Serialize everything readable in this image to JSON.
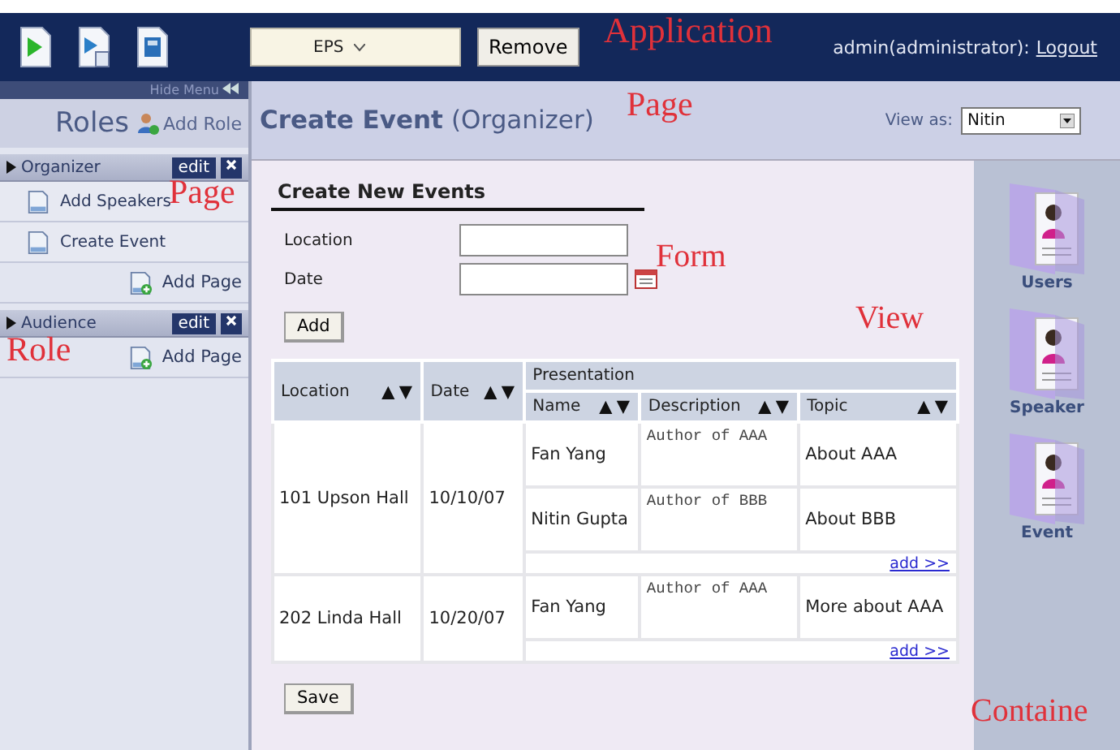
{
  "header": {
    "format_select": {
      "value": "EPS"
    },
    "remove_button": "Remove",
    "user": "admin(administrator):",
    "logout": "Logout"
  },
  "sidebar": {
    "hide_menu": "Hide Menu",
    "title": "Roles",
    "add_role": "Add Role",
    "roles": [
      {
        "name": "Organizer",
        "edit": "edit",
        "pages": [
          "Add Speakers",
          "Create Event"
        ],
        "add_page": "Add Page"
      },
      {
        "name": "Audience",
        "edit": "edit",
        "add_page": "Add Page"
      }
    ]
  },
  "page": {
    "title": "Create Event",
    "subtitle": "(Organizer)",
    "view_as": {
      "label": "View as:",
      "value": "Nitin"
    }
  },
  "form": {
    "title": "Create New Events",
    "fields": [
      {
        "label": "Location",
        "kind": "text"
      },
      {
        "label": "Date",
        "kind": "date"
      }
    ],
    "add_button": "Add"
  },
  "table": {
    "columns": [
      "Location",
      "Date"
    ],
    "group": "Presentation",
    "subcolumns": [
      "Name",
      "Description",
      "Topic"
    ],
    "rows": [
      {
        "location": "101 Upson Hall",
        "date": "10/10/07",
        "presentations": [
          {
            "name": "Fan Yang",
            "description": "Author of AAA",
            "topic": "About AAA"
          },
          {
            "name": "Nitin Gupta",
            "description": "Author of BBB",
            "topic": "About BBB"
          }
        ],
        "add_link": "add >>"
      },
      {
        "location": "202 Linda Hall",
        "date": "10/20/07",
        "presentations": [
          {
            "name": "Fan Yang",
            "description": "Author of AAA",
            "topic": "More about AAA"
          }
        ],
        "add_link": "add >>"
      }
    ]
  },
  "save_button": "Save",
  "containers": [
    {
      "label": "Users"
    },
    {
      "label": "Speaker"
    },
    {
      "label": "Event"
    }
  ],
  "annotations": [
    {
      "text": "Application"
    },
    {
      "text": "Page"
    },
    {
      "text": "Page"
    },
    {
      "text": "Form"
    },
    {
      "text": "View"
    },
    {
      "text": "Role"
    },
    {
      "text": "Containe"
    }
  ]
}
